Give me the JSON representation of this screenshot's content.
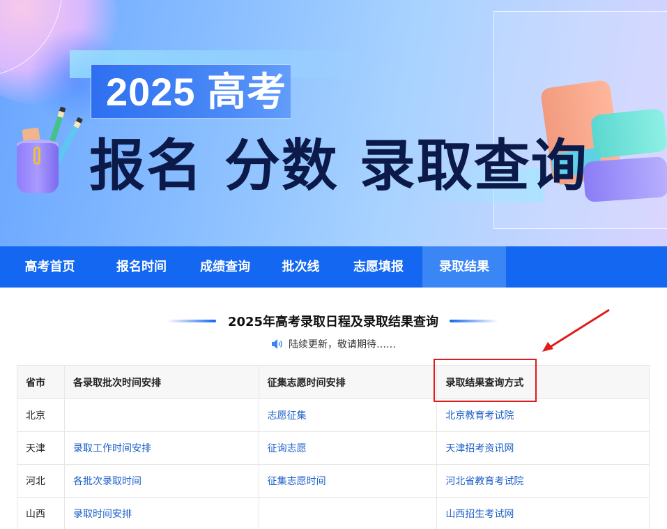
{
  "banner": {
    "year_title": "2025 高考",
    "headline": "报名 分数 录取查询",
    "colors": {
      "primary": "#1467f0",
      "headline": "#0c1a4a"
    }
  },
  "nav": {
    "items": [
      {
        "label": "高考首页",
        "active": false
      },
      {
        "label": "报名时间",
        "active": false
      },
      {
        "label": "成绩查询",
        "active": false
      },
      {
        "label": "批次线",
        "active": false
      },
      {
        "label": "志愿填报",
        "active": false
      },
      {
        "label": "录取结果",
        "active": true
      }
    ]
  },
  "section": {
    "title": "2025年高考录取日程及录取结果查询",
    "notice": "陆续更新，敬请期待……",
    "notice_icon": "speaker-icon"
  },
  "table": {
    "headers": [
      "省市",
      "各录取批次时间安排",
      "征集志愿时间安排",
      "录取结果查询方式"
    ],
    "rows": [
      {
        "province": "北京",
        "batch_schedule": "",
        "supplement": "志愿征集",
        "query": "北京教育考试院"
      },
      {
        "province": "天津",
        "batch_schedule": "录取工作时间安排",
        "supplement": "征询志愿",
        "query": "天津招考资讯网"
      },
      {
        "province": "河北",
        "batch_schedule": "各批次录取时间",
        "supplement": "征集志愿时间",
        "query": "河北省教育考试院"
      },
      {
        "province": "山西",
        "batch_schedule": "录取时间安排",
        "supplement": "",
        "query": "山西招生考试网"
      }
    ]
  },
  "annotation": {
    "highlight_color": "#e01b1b"
  }
}
